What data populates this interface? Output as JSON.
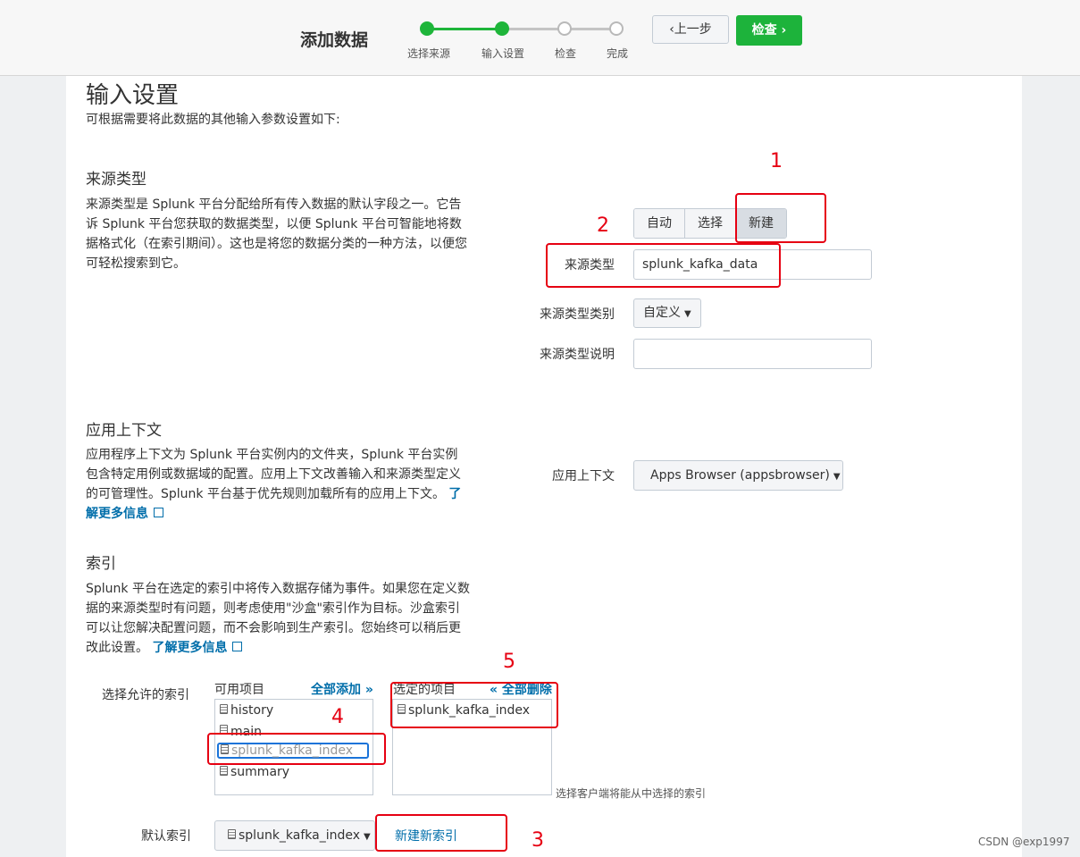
{
  "header": {
    "title": "添加数据",
    "steps": [
      {
        "label": "选择来源",
        "done": true
      },
      {
        "label": "输入设置",
        "done": true
      },
      {
        "label": "检查",
        "done": false
      },
      {
        "label": "完成",
        "done": false
      }
    ],
    "prev_label": "上一步",
    "prev_glyph": "‹",
    "next_label": "检查",
    "next_glyph": "›"
  },
  "page": {
    "title": "输入设置",
    "subtitle": "可根据需要将此数据的其他输入参数设置如下:"
  },
  "source_type": {
    "heading": "来源类型",
    "desc": "来源类型是 Splunk 平台分配给所有传入数据的默认字段之一。它告诉 Splunk 平台您获取的数据类型，以便 Splunk 平台可智能地将数据格式化（在索引期间）。这也是将您的数据分类的一种方法，以便您可轻松搜索到它。",
    "segments": [
      "自动",
      "选择",
      "新建"
    ],
    "name_label": "来源类型",
    "name_value": "splunk_kafka_data",
    "category_label": "来源类型类别",
    "category_value": "自定义",
    "description_label": "来源类型说明",
    "description_value": ""
  },
  "app_context": {
    "heading": "应用上下文",
    "desc": "应用程序上下文为 Splunk 平台实例内的文件夹，Splunk 平台实例包含特定用例或数据域的配置。应用上下文改善输入和来源类型定义的可管理性。Splunk 平台基于优先规则加载所有的应用上下文。",
    "learn_more": "了解更多信息",
    "label": "应用上下文",
    "value": "Apps Browser (appsbrowser)"
  },
  "index": {
    "heading": "索引",
    "desc": "Splunk 平台在选定的索引中将传入数据存储为事件。如果您在定义数据的来源类型时有问题，则考虑使用\"沙盒\"索引作为目标。沙盒索引可以让您解决配置问题，而不会影响到生产索引。您始终可以稍后更改此设置。",
    "learn_more": "了解更多信息",
    "allowed_label": "选择允许的索引",
    "available_header": "可用项目",
    "add_all": "全部添加 »",
    "available_items": [
      "history",
      "main",
      "splunk_kafka_index",
      "summary"
    ],
    "selected_header": "选定的项目",
    "remove_all": "« 全部删除",
    "selected_items": [
      "splunk_kafka_index"
    ],
    "hint": "选择客户端将能从中选择的索引",
    "default_label": "默认索引",
    "default_value": "splunk_kafka_index",
    "new_index": "新建新索引"
  },
  "annotations": [
    "1",
    "2",
    "3",
    "4",
    "5"
  ],
  "watermark": "CSDN @exp1997",
  "colors": {
    "accent_green": "#1eb53a",
    "link_blue": "#006eaa",
    "annotation_red": "#e60012"
  }
}
